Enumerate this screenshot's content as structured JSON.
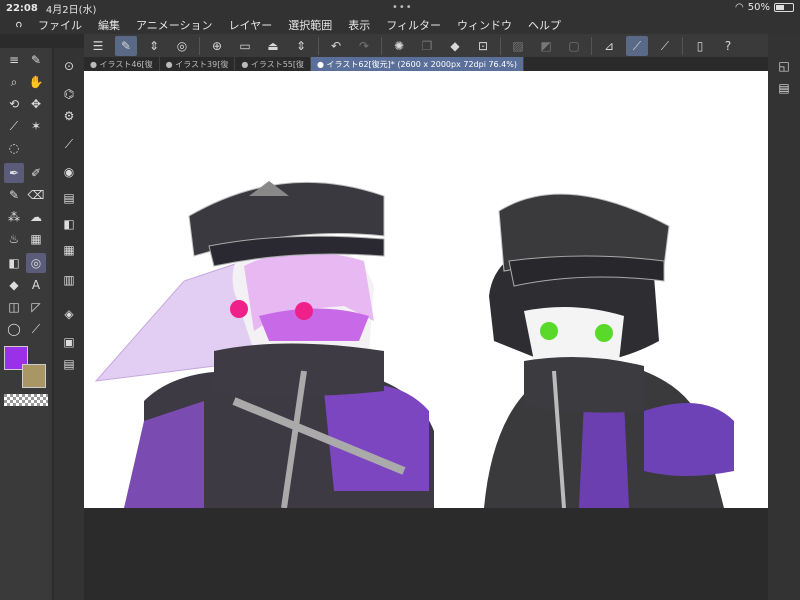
{
  "status_bar": {
    "time": "22:08",
    "date": "4月2日(水)",
    "battery": "50%",
    "battery_level": 0.5
  },
  "menu": {
    "items": [
      "ファイル",
      "編集",
      "アニメーション",
      "レイヤー",
      "選択範囲",
      "表示",
      "フィルター",
      "ウィンドウ",
      "ヘルプ"
    ]
  },
  "tabs": [
    {
      "label": "● イラスト46[復"
    },
    {
      "label": "● イラスト39[復"
    },
    {
      "label": "● イラスト55[復"
    },
    {
      "label": "● イラスト62[復元]* (2600 x 2000px 72dpi 76.4%)"
    }
  ],
  "colors": {
    "main": "#9a30e8",
    "sub": "#a89665",
    "accent": "#5a6f9a"
  }
}
